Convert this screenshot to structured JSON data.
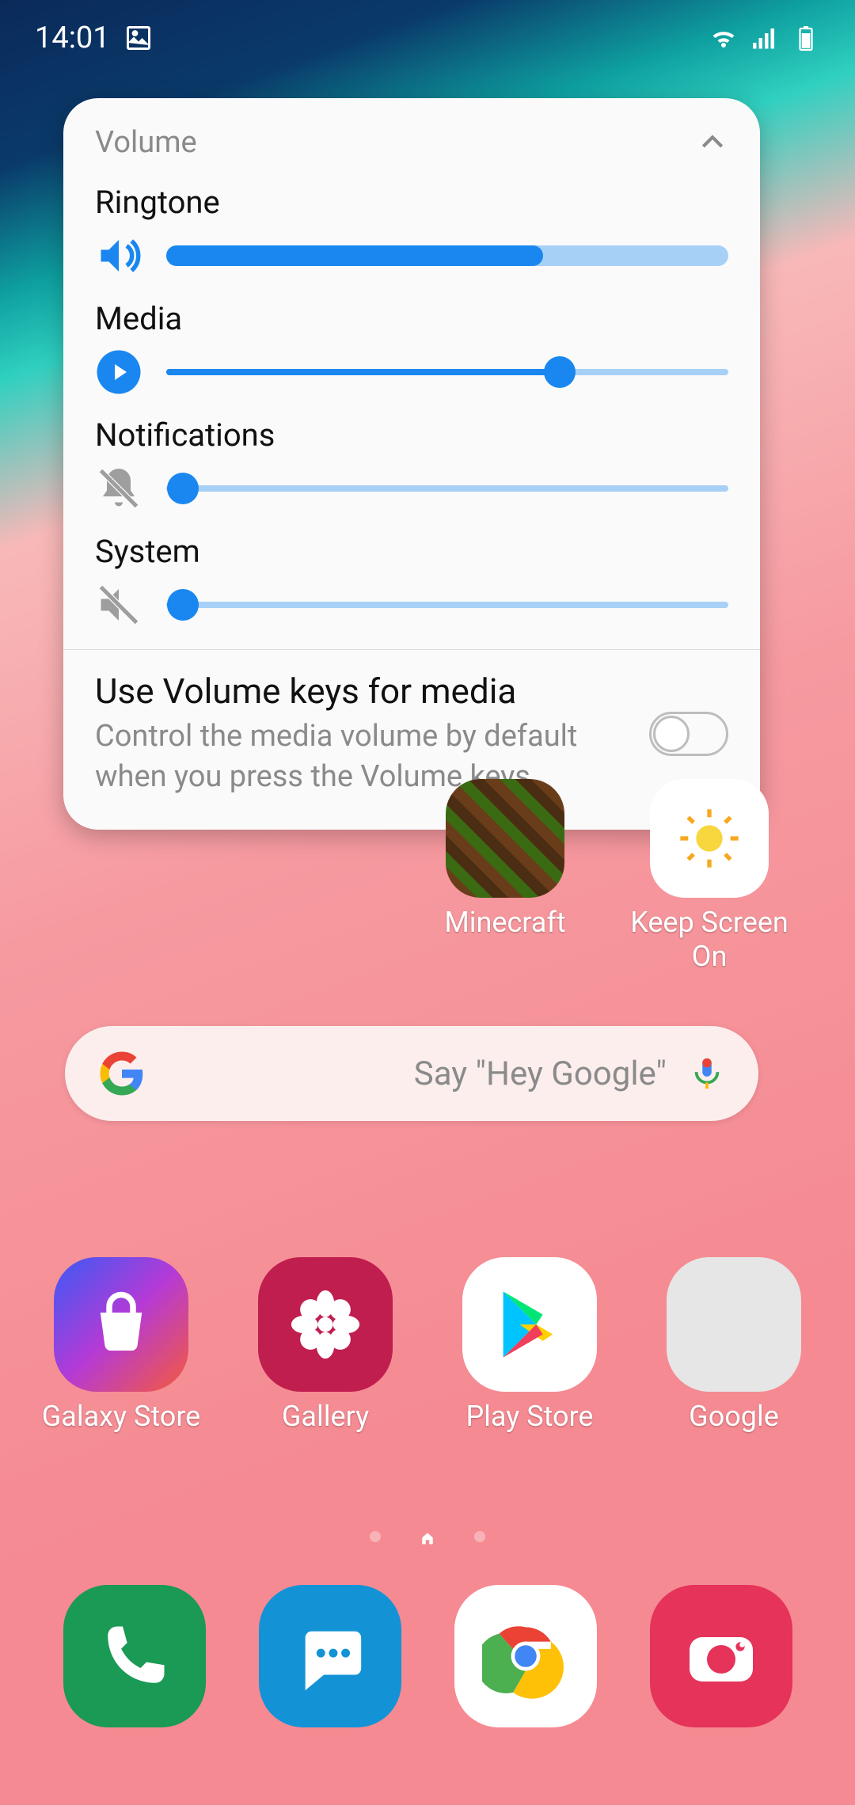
{
  "status_bar": {
    "time": "14:01"
  },
  "volume_panel": {
    "title": "Volume",
    "sliders": {
      "ringtone": {
        "label": "Ringtone",
        "value": 67
      },
      "media": {
        "label": "Media",
        "value": 70
      },
      "notifications": {
        "label": "Notifications",
        "value": 0
      },
      "system": {
        "label": "System",
        "value": 0
      }
    },
    "media_keys": {
      "title": "Use Volume keys for media",
      "desc": "Control the media volume by default when you press the Volume keys.",
      "enabled": false
    }
  },
  "home_apps": {
    "minecraft": "Minecraft",
    "keep_screen_on": "Keep Screen On"
  },
  "search": {
    "placeholder": "Say \"Hey Google\""
  },
  "app_row": {
    "galaxy_store": "Galaxy Store",
    "gallery": "Gallery",
    "play_store": "Play Store",
    "google_folder": "Google"
  }
}
